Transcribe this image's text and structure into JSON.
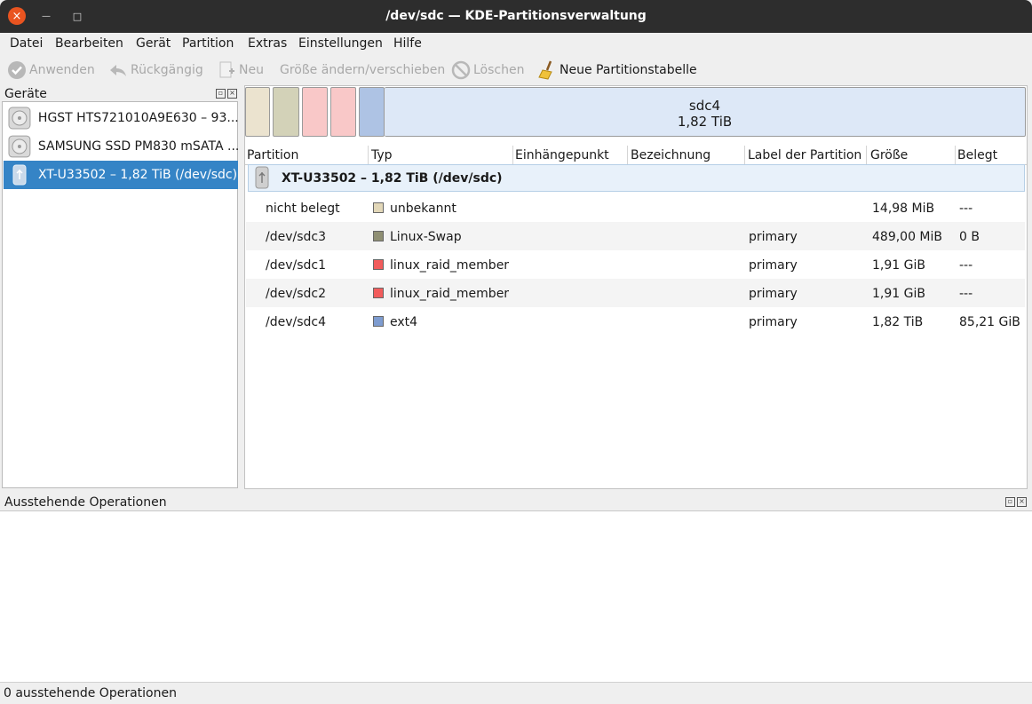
{
  "window": {
    "title": "/dev/sdc — KDE-Partitionsverwaltung",
    "close_glyph": "×",
    "min_glyph": "—",
    "max_glyph": "□"
  },
  "menu": [
    "Datei",
    "Bearbeiten",
    "Gerät",
    "Partition",
    "Extras",
    "Einstellungen",
    "Hilfe"
  ],
  "toolbar": {
    "apply": "Anwenden",
    "undo": "Rückgängig",
    "new": "Neu",
    "resize": "Größe ändern/verschieben",
    "delete": "Löschen",
    "new_table": "Neue Partitionstabelle"
  },
  "devices_panel": {
    "title": "Geräte",
    "items": [
      {
        "label": "HGST HTS721010A9E630 – 93...",
        "icon": "harddisk-icon"
      },
      {
        "label": "SAMSUNG SSD PM830 mSATA ...",
        "icon": "harddisk-icon"
      },
      {
        "label": "XT-U33502 – 1,82 TiB (/dev/sdc)",
        "icon": "usb-drive-icon",
        "selected": true
      }
    ]
  },
  "disk_graph": {
    "selected_name": "sdc4",
    "selected_size": "1,82 TiB",
    "colors": [
      "#e8e0cc",
      "#cfcfb2",
      "#f9c5c5",
      "#f9c5c5",
      "#a9bfe0",
      "#dde8f7"
    ]
  },
  "table": {
    "headers": [
      "Partition",
      "Typ",
      "Einhängepunkt",
      "Bezeichnung",
      "Label der Partition",
      "Größe",
      "Belegt"
    ],
    "disk_row": "XT-U33502 – 1,82 TiB (/dev/sdc)",
    "rows": [
      {
        "partition": "nicht belegt",
        "type": "unbekannt",
        "color": "#d9ceb0",
        "label": "",
        "size": "14,98 MiB",
        "used": "---"
      },
      {
        "partition": "/dev/sdc3",
        "type": "Linux-Swap",
        "color": "#8f8f73",
        "label": "primary",
        "size": "489,00 MiB",
        "used": "0 B"
      },
      {
        "partition": "/dev/sdc1",
        "type": "linux_raid_member",
        "color": "#f25c5c",
        "label": "primary",
        "size": "1,91 GiB",
        "used": "---"
      },
      {
        "partition": "/dev/sdc2",
        "type": "linux_raid_member",
        "color": "#f25c5c",
        "label": "primary",
        "size": "1,91 GiB",
        "used": "---"
      },
      {
        "partition": "/dev/sdc4",
        "type": "ext4",
        "color": "#7e9cd0",
        "label": "primary",
        "size": "1,82 TiB",
        "used": "85,21 GiB"
      }
    ]
  },
  "pending_panel": {
    "title": "Ausstehende Operationen"
  },
  "status": "0 ausstehende Operationen"
}
